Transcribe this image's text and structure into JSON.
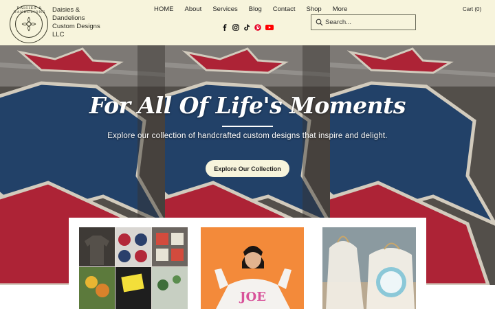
{
  "header": {
    "logo_text": "DAISIES & DANDELIONS",
    "brand_lines": [
      "Daisies &",
      "Dandelions",
      "Custom Designs",
      "LLC"
    ],
    "nav": [
      "HOME",
      "About",
      "Services",
      "Blog",
      "Contact",
      "Shop",
      "More"
    ],
    "socials": [
      "facebook-icon",
      "instagram-icon",
      "tiktok-icon",
      "pinterest-icon",
      "youtube-icon"
    ],
    "search": {
      "placeholder": "Search..."
    },
    "cart_label": "Cart (0)"
  },
  "hero": {
    "title": "For All Of Life's Moments",
    "subtitle": "Explore our collection of handcrafted custom designs that inspire and delight.",
    "button_label": "Explore Our Collection"
  },
  "cards": {
    "shirt_text": "JOE"
  },
  "colors": {
    "header_bg": "#f7f4dc",
    "button_bg": "#f7f4dc",
    "crochet_red": "#c5283e",
    "crochet_blue": "#274a77",
    "crochet_cream": "#efe8d8"
  }
}
